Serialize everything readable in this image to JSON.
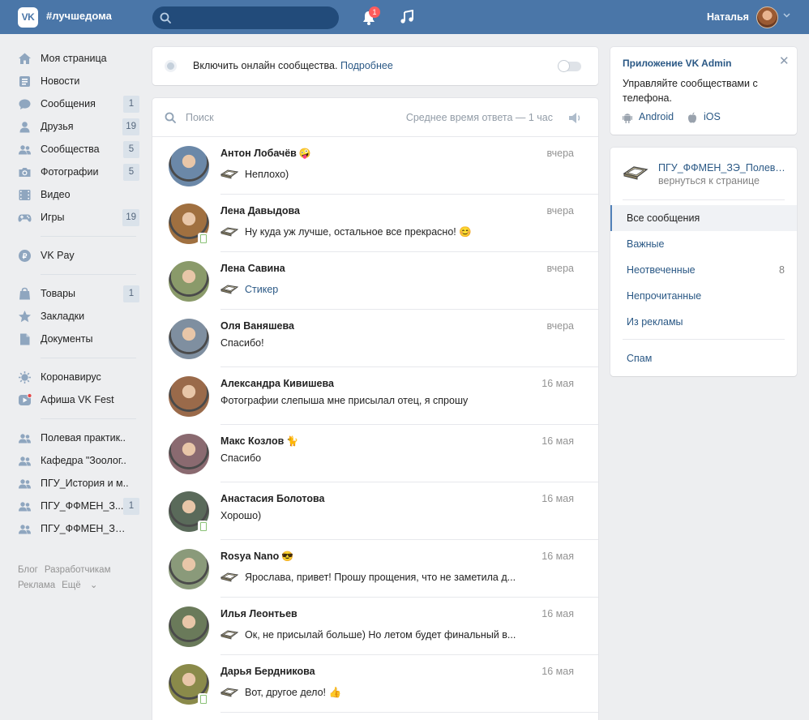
{
  "header": {
    "logo_text": "VK",
    "hashtag": "#лучшедома",
    "search_placeholder": "",
    "notifications_count": "1",
    "user_name": "Наталья"
  },
  "nav": {
    "main": [
      {
        "label": "Моя страница",
        "icon": "home-icon",
        "count": ""
      },
      {
        "label": "Новости",
        "icon": "news-icon",
        "count": ""
      },
      {
        "label": "Сообщения",
        "icon": "messages-icon",
        "count": "1"
      },
      {
        "label": "Друзья",
        "icon": "friends-icon",
        "count": "19"
      },
      {
        "label": "Сообщества",
        "icon": "groups-icon",
        "count": "5"
      },
      {
        "label": "Фотографии",
        "icon": "camera-icon",
        "count": "5"
      },
      {
        "label": "Видео",
        "icon": "video-icon",
        "count": ""
      },
      {
        "label": "Игры",
        "icon": "gamepad-icon",
        "count": "19"
      }
    ],
    "pay": [
      {
        "label": "VK Pay",
        "icon": "vkpay-icon",
        "count": ""
      }
    ],
    "tools": [
      {
        "label": "Товары",
        "icon": "bag-icon",
        "count": "1"
      },
      {
        "label": "Закладки",
        "icon": "star-icon",
        "count": ""
      },
      {
        "label": "Документы",
        "icon": "document-icon",
        "count": ""
      }
    ],
    "special": [
      {
        "label": "Коронавирус",
        "icon": "virus-icon",
        "count": ""
      },
      {
        "label": "Афиша VK Fest",
        "icon": "play-icon",
        "count": ""
      }
    ],
    "groups": [
      {
        "label": "Полевая практик..",
        "icon": "group-icon",
        "count": ""
      },
      {
        "label": "Кафедра \"Зоолог..",
        "icon": "group-icon",
        "count": ""
      },
      {
        "label": "ПГУ_История и м..",
        "icon": "group-icon",
        "count": ""
      },
      {
        "label": "ПГУ_ФФМЕН_З...",
        "icon": "group-icon",
        "count": "1"
      },
      {
        "label": "ПГУ_ФФМЕН_ЗЭ_П...",
        "icon": "group-icon",
        "count": ""
      }
    ],
    "footer": [
      "Блог",
      "Разработчикам",
      "Реклама",
      "Ещё"
    ]
  },
  "online": {
    "text": "Включить онлайн сообщества.",
    "link": "Подробнее"
  },
  "dialogs": {
    "search_placeholder": "Поиск",
    "avg_response": "Среднее время ответа — 1 час",
    "items": [
      {
        "name": "Антон Лобачёв",
        "emoji": "🤪",
        "time": "вчера",
        "msg": "Неплохо)",
        "group_icon": true,
        "sticker": false,
        "mobile": false,
        "avatar_color": "#6b88a8"
      },
      {
        "name": "Лена Давыдова",
        "emoji": "",
        "time": "вчера",
        "msg": "Ну куда уж лучше, остальное все прекрасно! 😊",
        "group_icon": true,
        "sticker": false,
        "mobile": true,
        "avatar_color": "#a07040"
      },
      {
        "name": "Лена Савина",
        "emoji": "",
        "time": "вчера",
        "msg": "Стикер",
        "group_icon": true,
        "sticker": true,
        "mobile": false,
        "avatar_color": "#8a9a6a"
      },
      {
        "name": "Оля Ваняшева",
        "emoji": "",
        "time": "вчера",
        "msg": "Спасибо!",
        "group_icon": false,
        "sticker": false,
        "mobile": false,
        "avatar_color": "#7f8fa0"
      },
      {
        "name": "Александра Кивишева",
        "emoji": "",
        "time": "16 мая",
        "msg": "Фотографии слепыша мне присылал отец, я спрошу",
        "group_icon": false,
        "sticker": false,
        "mobile": false,
        "avatar_color": "#9a6a4a"
      },
      {
        "name": "Макс Козлов",
        "emoji": "🐈",
        "time": "16 мая",
        "msg": "Спасибо",
        "group_icon": false,
        "sticker": false,
        "mobile": false,
        "avatar_color": "#8a6a70"
      },
      {
        "name": "Анастасия Болотова",
        "emoji": "",
        "time": "16 мая",
        "msg": "Хорошо)",
        "group_icon": false,
        "sticker": false,
        "mobile": true,
        "avatar_color": "#5a6a5a"
      },
      {
        "name": "Rosya Nano",
        "emoji": "😎",
        "time": "16 мая",
        "msg": "Ярослава, привет! Прошу прощения, что не заметила д...",
        "group_icon": true,
        "sticker": false,
        "mobile": false,
        "avatar_color": "#8a9a7a"
      },
      {
        "name": "Илья Леонтьев",
        "emoji": "",
        "time": "16 мая",
        "msg": "Ок, не присылай больше) Но летом будет финальный в...",
        "group_icon": true,
        "sticker": false,
        "mobile": false,
        "avatar_color": "#6a7a5a"
      },
      {
        "name": "Дарья Бердникова",
        "emoji": "",
        "time": "16 мая",
        "msg": "Вот, другое дело! 👍",
        "group_icon": true,
        "sticker": false,
        "mobile": true,
        "avatar_color": "#8a8a4a"
      }
    ]
  },
  "admin": {
    "title": "Приложение VK Admin",
    "desc": "Управляйте сообществами с телефона.",
    "android": "Android",
    "ios": "iOS"
  },
  "filters": {
    "group_name": "ПГУ_ФФМЕН_ЗЭ_Полевая практика",
    "back": "вернуться к странице",
    "items": [
      {
        "label": "Все сообщения",
        "count": "",
        "active": true
      },
      {
        "label": "Важные",
        "count": "",
        "active": false
      },
      {
        "label": "Неотвеченные",
        "count": "8",
        "active": false
      },
      {
        "label": "Непрочитанные",
        "count": "",
        "active": false
      },
      {
        "label": "Из рекламы",
        "count": "",
        "active": false
      }
    ],
    "spam": "Спам"
  },
  "colors": {
    "header": "#4a76a8",
    "link": "#2a5885",
    "background": "#edeef0"
  }
}
